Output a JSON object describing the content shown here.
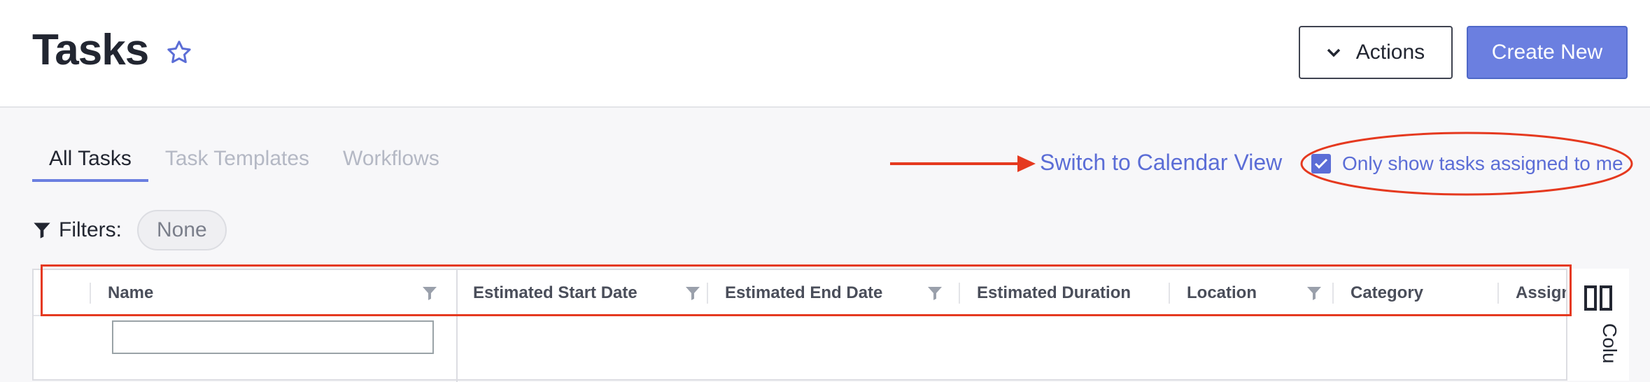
{
  "header": {
    "title": "Tasks",
    "actions_label": "Actions",
    "create_label": "Create New"
  },
  "tabs": [
    {
      "label": "All Tasks",
      "active": true
    },
    {
      "label": "Task Templates",
      "active": false
    },
    {
      "label": "Workflows",
      "active": false
    }
  ],
  "calendar_link": "Switch to Calendar View",
  "assigned_filter": {
    "label": "Only show tasks assigned to me",
    "checked": true
  },
  "filters": {
    "label": "Filters:",
    "value": "None"
  },
  "grid": {
    "columns": [
      {
        "label": "Name",
        "filterable": true
      },
      {
        "label": "Estimated Start Date",
        "filterable": true
      },
      {
        "label": "Estimated End Date",
        "filterable": true
      },
      {
        "label": "Estimated Duration",
        "filterable": false
      },
      {
        "label": "Location",
        "filterable": true
      },
      {
        "label": "Category",
        "filterable": false
      },
      {
        "label": "Assigne",
        "filterable": false
      }
    ],
    "name_filter_value": ""
  },
  "side_panel": {
    "label": "Colu"
  },
  "colors": {
    "accent": "#6b7fe0",
    "link": "#5b6dd6",
    "annotation": "#e5391f"
  },
  "icons": [
    "star-icon",
    "chevron-down-icon",
    "filter-icon",
    "checkbox-check-icon",
    "columns-icon",
    "arrow-right-icon"
  ]
}
